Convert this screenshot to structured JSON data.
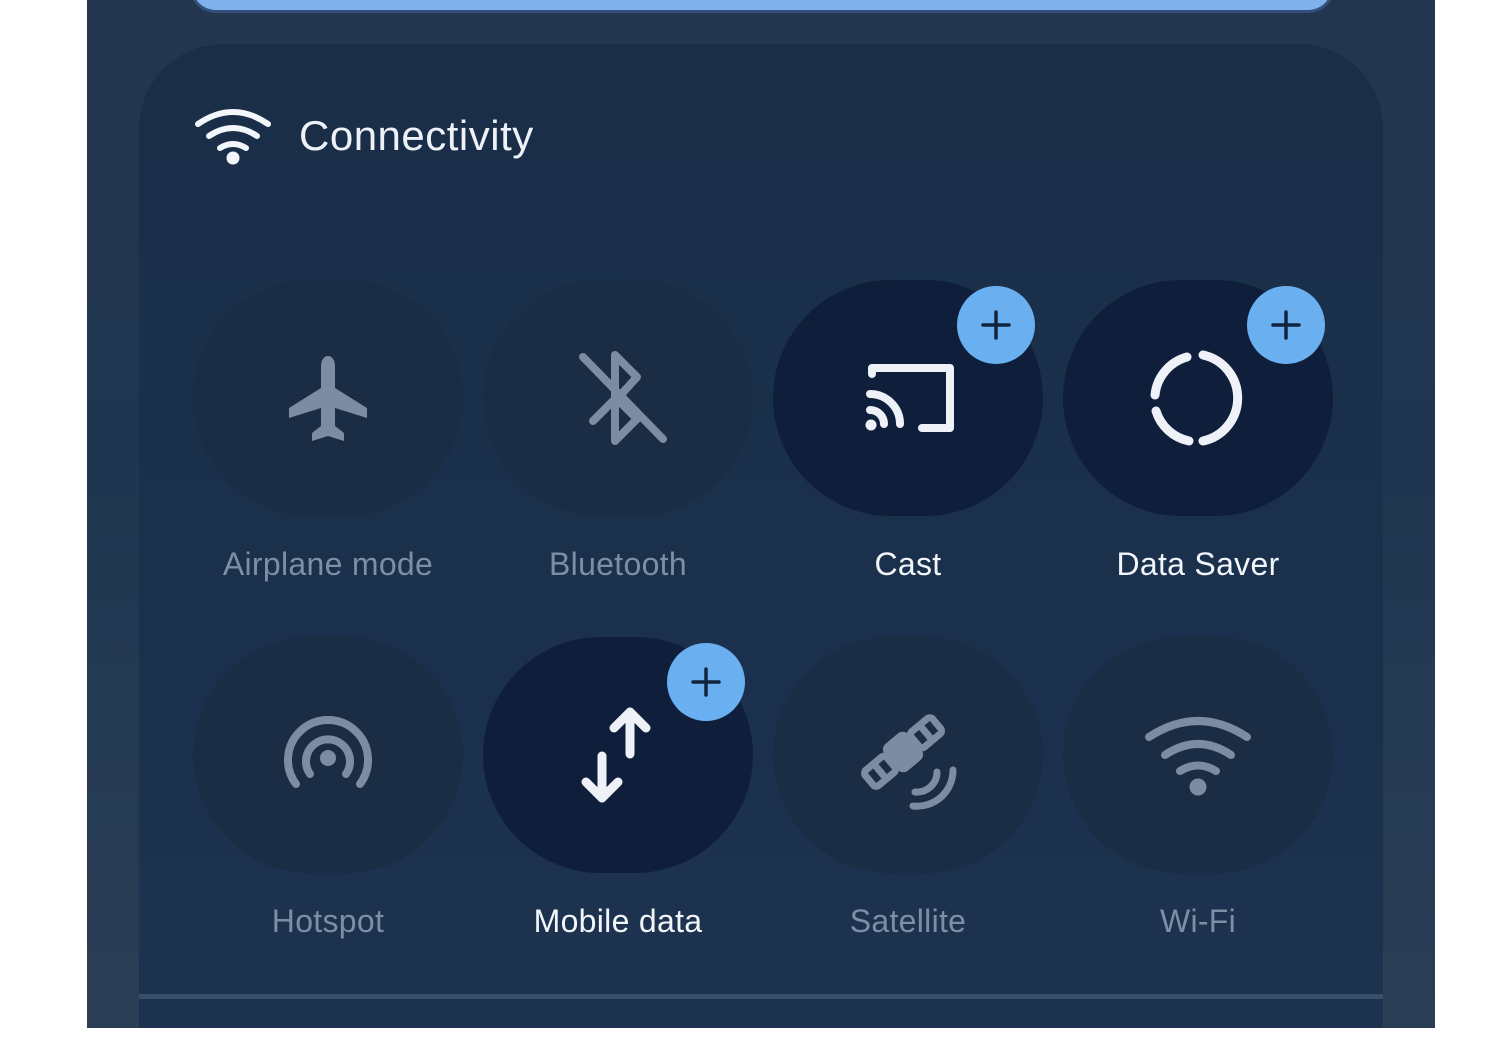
{
  "header": {
    "title": "Connectivity",
    "icon": "wifi-icon"
  },
  "tiles": [
    {
      "label": "Airplane mode",
      "icon": "airplane-icon",
      "state": "off",
      "badge": false
    },
    {
      "label": "Bluetooth",
      "icon": "bluetooth-off-icon",
      "state": "off",
      "badge": false
    },
    {
      "label": "Cast",
      "icon": "cast-icon",
      "state": "on",
      "badge": true
    },
    {
      "label": "Data Saver",
      "icon": "data-saver-icon",
      "state": "on",
      "badge": true
    },
    {
      "label": "Hotspot",
      "icon": "hotspot-icon",
      "state": "off",
      "badge": false
    },
    {
      "label": "Mobile data",
      "icon": "mobile-data-icon",
      "state": "on",
      "badge": true
    },
    {
      "label": "Satellite",
      "icon": "satellite-icon",
      "state": "off",
      "badge": false
    },
    {
      "label": "Wi-Fi",
      "icon": "wifi-icon",
      "state": "off",
      "badge": false
    }
  ],
  "badge_icon": "plus-icon",
  "colors": {
    "accent": "#6ab0f0",
    "active_label": "#f2f5fa",
    "inactive_label": "#7f8ea4",
    "active_tile": "#0f1f3b",
    "inactive_tile": "#1b2c45"
  }
}
